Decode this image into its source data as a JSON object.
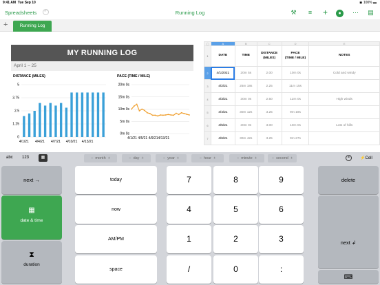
{
  "status": {
    "time": "9:41 AM",
    "date": "Tue Sep 10",
    "battery": "100%"
  },
  "toolbar": {
    "back": "Spreadsheets",
    "title": "Running Log"
  },
  "tabs": [
    {
      "label": "Running Log"
    }
  ],
  "sheet": {
    "banner": "MY RUNNING LOG",
    "date_range": "April 1 – 25",
    "distance_title": "DISTANCE (MILES)",
    "pace_title": "PACE (TIME / MILE)"
  },
  "grid": {
    "columns": [
      "A",
      "B",
      "C",
      "D",
      "E"
    ],
    "headers": [
      "DATE",
      "TIME",
      "DISTANCE\n(MILES)",
      "PACE\n(TIME / MILE)",
      "NOTES"
    ],
    "rows": [
      {
        "num": "1"
      },
      {
        "num": "2",
        "cells": [
          "4/1/2021",
          "20m 5s",
          "2.00",
          "10m 0s",
          "Cold and windy"
        ]
      },
      {
        "num": "3",
        "cells": [
          "4/2/21",
          "25m 18s",
          "2.25",
          "11m 15s",
          ""
        ]
      },
      {
        "num": "4",
        "cells": [
          "4/3/21",
          "30m 0s",
          "2.50",
          "12m 0s",
          "High winds"
        ]
      },
      {
        "num": "5",
        "cells": [
          "4/4/21",
          "30m 12s",
          "3.25",
          "9m 18s",
          ""
        ]
      },
      {
        "num": "6",
        "cells": [
          "4/5/21",
          "30m 0s",
          "3.00",
          "10m 0s",
          "Lots of hills"
        ]
      },
      {
        "num": "7",
        "cells": [
          "4/6/21",
          "30m 42s",
          "3.25",
          "9m 27s",
          ""
        ]
      }
    ]
  },
  "chart_data": [
    {
      "type": "bar",
      "title": "DISTANCE (MILES)",
      "categories": [
        "4/1",
        "4/2",
        "4/3",
        "4/4",
        "4/5",
        "4/6",
        "4/7",
        "4/8",
        "4/9",
        "4/10",
        "4/11",
        "4/12",
        "4/13",
        "4/14",
        "4/15",
        "4/16"
      ],
      "xticks": [
        "4/1/21",
        "4/4/21",
        "4/7/21",
        "4/10/21",
        "4/13/21"
      ],
      "values": [
        2.0,
        2.25,
        2.5,
        3.25,
        3.0,
        3.25,
        3.0,
        3.25,
        2.8,
        4.25,
        4.25,
        4.25,
        4.25,
        4.25,
        4.25,
        4.25
      ],
      "yticks": [
        "0",
        "1.25",
        "2.5",
        "3.75",
        "5"
      ],
      "ylim": [
        0,
        5
      ],
      "color": "#3aa0d8"
    },
    {
      "type": "line",
      "title": "PACE (TIME / MILE)",
      "categories": [
        "4/1",
        "4/2",
        "4/3",
        "4/4",
        "4/5",
        "4/6",
        "4/7",
        "4/8",
        "4/9",
        "4/10",
        "4/11",
        "4/12",
        "4/13",
        "4/14",
        "4/15",
        "4/16",
        "4/17",
        "4/18",
        "4/19",
        "4/20",
        "4/21",
        "4/22",
        "4/23"
      ],
      "xticks": [
        "4/1/21",
        "4/5/21",
        "4/9/21",
        "4/13/21"
      ],
      "values_min": [
        10,
        11.25,
        12,
        9.3,
        10,
        9.45,
        8.5,
        8.2,
        7.5,
        7.5,
        7.2,
        7.6,
        7.5,
        7.6,
        7.8,
        7.6,
        7.5,
        8.3,
        7.8,
        8.5,
        8.2,
        7.9,
        7.6
      ],
      "yticks": [
        "0m 0s",
        "5m 0s",
        "10m 0s",
        "15m 0s",
        "20m 0s"
      ],
      "ylim": [
        0,
        20
      ],
      "color": "#f0a030"
    }
  ],
  "keyboard": {
    "modes": [
      "abc",
      "123"
    ],
    "units": [
      "month",
      "day",
      "year",
      "hour",
      "minute",
      "second"
    ],
    "cell_label": "Cell",
    "left_keys": [
      "next →",
      "date & time",
      "duration"
    ],
    "mid_keys": [
      "today",
      "now",
      "AM/PM",
      "space"
    ],
    "digits": [
      "7",
      "8",
      "9",
      "4",
      "5",
      "6",
      "1",
      "2",
      "3",
      "/",
      "0",
      ":"
    ],
    "right_keys": [
      "delete",
      "next"
    ]
  }
}
